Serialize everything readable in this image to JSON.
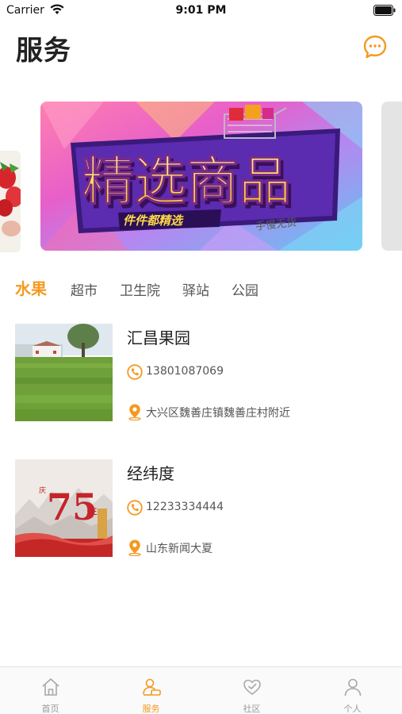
{
  "status_bar": {
    "carrier": "Carrier",
    "time": "9:01 PM"
  },
  "header": {
    "title": "服务",
    "message_icon": "chat-bubble-icon"
  },
  "banner": {
    "headline": "精选商品",
    "tagline": "件件都精选",
    "subline": "手慢无货"
  },
  "categories": [
    {
      "label": "水果",
      "active": true
    },
    {
      "label": "超市",
      "active": false
    },
    {
      "label": "卫生院",
      "active": false
    },
    {
      "label": "驿站",
      "active": false
    },
    {
      "label": "公园",
      "active": false
    }
  ],
  "stores": [
    {
      "name": "汇昌果园",
      "phone": "13801087069",
      "address": "大兴区魏善庄镇魏善庄村附近"
    },
    {
      "name": "经纬度",
      "phone": "12233334444",
      "address": "山东新闻大夏"
    }
  ],
  "tabbar": [
    {
      "label": "首页",
      "icon": "home-icon",
      "active": false
    },
    {
      "label": "服务",
      "icon": "service-icon",
      "active": true
    },
    {
      "label": "社区",
      "icon": "community-heart-icon",
      "active": false
    },
    {
      "label": "个人",
      "icon": "person-icon",
      "active": false
    }
  ],
  "colors": {
    "accent": "#f39a22",
    "text": "#222222",
    "muted": "#999999"
  }
}
